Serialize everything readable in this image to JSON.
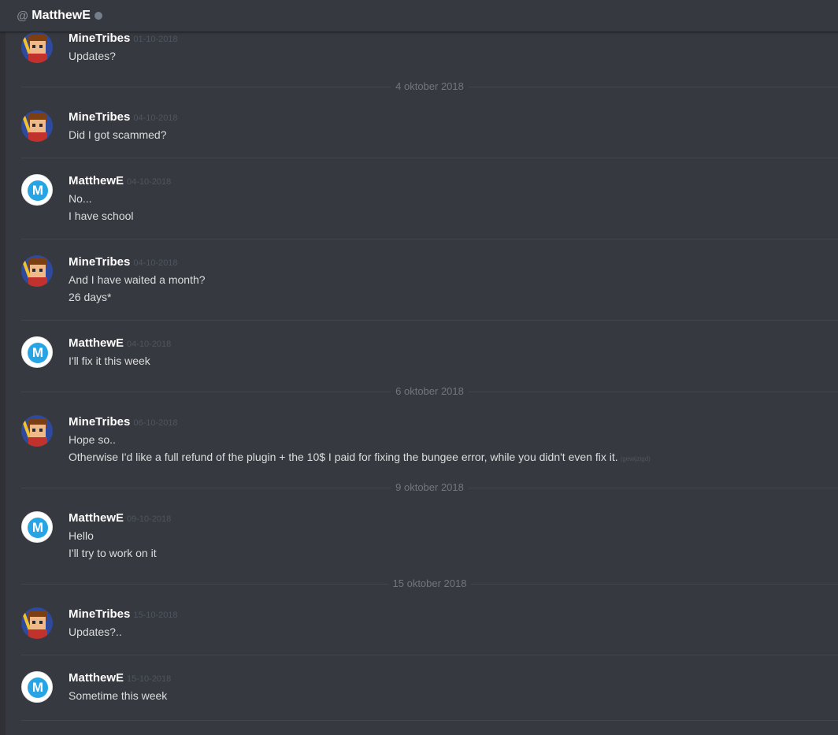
{
  "header": {
    "at_symbol": "@",
    "title": "MatthewE"
  },
  "date_separators": [
    "4 oktober 2018",
    "6 oktober 2018",
    "9 oktober 2018",
    "15 oktober 2018"
  ],
  "messages": [
    {
      "author": "MineTribes",
      "timestamp": "01-10-2018",
      "lines": [
        "Updates?"
      ]
    },
    {
      "author": "MineTribes",
      "timestamp": "04-10-2018",
      "lines": [
        "Did I got scammed?"
      ]
    },
    {
      "author": "MatthewE",
      "timestamp": "04-10-2018",
      "lines": [
        "No...",
        "I have school"
      ]
    },
    {
      "author": "MineTribes",
      "timestamp": "04-10-2018",
      "lines": [
        "And I have waited a month?",
        "26 days*"
      ]
    },
    {
      "author": "MatthewE",
      "timestamp": "04-10-2018",
      "lines": [
        "I'll fix it this week"
      ]
    },
    {
      "author": "MineTribes",
      "timestamp": "06-10-2018",
      "lines": [
        "Hope so..",
        "Otherwise I'd like a full refund of the plugin + the 10$ I paid for fixing the bungee error, while you didn't even fix it."
      ],
      "edited_label": "(gewijzigd)"
    },
    {
      "author": "MatthewE",
      "timestamp": "09-10-2018",
      "lines": [
        "Hello",
        "I'll try to work on it"
      ]
    },
    {
      "author": "MineTribes",
      "timestamp": "15-10-2018",
      "lines": [
        "Updates?.."
      ]
    },
    {
      "author": "MatthewE",
      "timestamp": "15-10-2018",
      "lines": [
        "Sometime this week"
      ]
    }
  ],
  "avatar_letter": "M",
  "colors": {
    "background": "#36393f",
    "accent_blue": "#27a4e4",
    "status_offline": "#747f8d"
  }
}
